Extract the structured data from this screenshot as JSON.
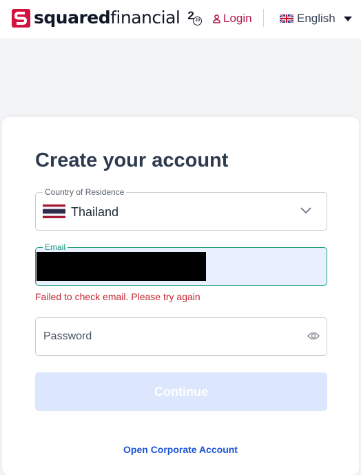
{
  "header": {
    "brand_bold": "squared",
    "brand_light": "financial",
    "anniversary": "2",
    "anniversary_small": "20",
    "login_label": "Login",
    "language_label": "English"
  },
  "form": {
    "title": "Create your account",
    "country_label": "Country of Residence",
    "country_value": "Thailand",
    "email_label": "Email",
    "email_error": "Failed to check email. Please try again",
    "password_placeholder": "Password",
    "continue_label": "Continue",
    "corporate_link": "Open Corporate Account"
  },
  "colors": {
    "brand_red": "#d3123e",
    "login_link": "#b5174a",
    "focus_green": "#1f9e7a",
    "error_red": "#c4232f",
    "button_disabled": "#dce6fc",
    "link_blue": "#1c54d4"
  },
  "icons": {
    "logo": "squared-logo-icon",
    "login": "user-icon",
    "language": "uk-flag-icon",
    "country": "thailand-flag-icon",
    "dropdown": "chevron-down-icon",
    "password_toggle": "eye-icon"
  }
}
